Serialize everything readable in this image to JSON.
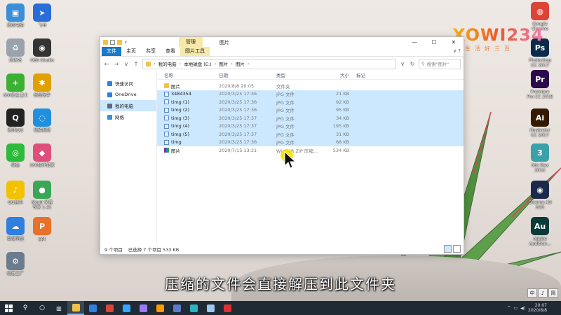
{
  "desktop_left": [
    {
      "label": "我的电脑",
      "color": "#3a8fd8",
      "glyph": "▣",
      "icon": "computer-icon"
    },
    {
      "label": "回收站",
      "color": "#9aa3ad",
      "glyph": "♻",
      "icon": "recycle-bin-icon"
    },
    {
      "label": "360安全卫士",
      "color": "#3cb035",
      "glyph": "+",
      "icon": "security-guard-icon"
    },
    {
      "label": "腾讯QQ",
      "color": "#222",
      "glyph": "Q",
      "icon": "qq-icon"
    },
    {
      "label": "微信",
      "color": "#2dbb3b",
      "glyph": "◎",
      "icon": "wechat-icon"
    },
    {
      "label": "QQ音乐",
      "color": "#f2c200",
      "glyph": "♪",
      "icon": "qq-music-icon"
    },
    {
      "label": "百度网盘",
      "color": "#2f7fe0",
      "glyph": "☁",
      "icon": "baidu-netdisk-icon"
    },
    {
      "label": "修复工厂",
      "color": "#6b7c8e",
      "glyph": "⚙",
      "icon": "repair-tool-icon"
    }
  ],
  "desktop_col2": [
    {
      "label": "飞书",
      "color": "#2a6cd8",
      "glyph": "➤",
      "icon": "feishu-icon"
    },
    {
      "label": "OBS Studio",
      "color": "#333",
      "glyph": "◉",
      "icon": "obs-icon"
    },
    {
      "label": "蚂蚁助手",
      "color": "#e0a000",
      "glyph": "✱",
      "icon": "ant-assistant-icon"
    },
    {
      "label": "优酷视频",
      "color": "#1f8fe0",
      "glyph": "◌",
      "icon": "youku-icon"
    },
    {
      "label": "360软件管家",
      "color": "#e04f7c",
      "glyph": "◆",
      "icon": "software-manager-icon"
    },
    {
      "label": "Moo0 录音\n专家 1.41",
      "color": "#3aa657",
      "glyph": "●",
      "icon": "recorder-icon"
    },
    {
      "label": "ppt",
      "color": "#e8702a",
      "glyph": "P",
      "icon": "ppt-file-icon"
    }
  ],
  "desktop_right": [
    {
      "label": "Google\nChrome",
      "color": "#db4437",
      "glyph": "◍",
      "icon": "chrome-icon"
    },
    {
      "label": "Photoshop\nCC 2017",
      "color": "#0a2b4c",
      "glyph": "Ps",
      "icon": "photoshop-icon"
    },
    {
      "label": "Premiere\nPro CC 2018",
      "color": "#2a0a4a",
      "glyph": "Pr",
      "icon": "premiere-icon"
    },
    {
      "label": "Illustrator\nCC 2017",
      "color": "#331a00",
      "glyph": "Ai",
      "icon": "illustrator-icon"
    },
    {
      "label": "3ds Max\n2015",
      "color": "#3aa1a8",
      "glyph": "3",
      "icon": "3dsmax-icon"
    },
    {
      "label": "Cinema 4D\nR20",
      "color": "#1b2a4a",
      "glyph": "◉",
      "icon": "cinema4d-icon"
    },
    {
      "label": "Adobe\nAudition...",
      "color": "#0a3a3a",
      "glyph": "Au",
      "icon": "audition-icon"
    }
  ],
  "watermark": {
    "logo": "XOWI234",
    "sub": "好生活好三百"
  },
  "window": {
    "title": "图片",
    "context_tab": "管理",
    "ribbon_tabs": [
      "文件",
      "主页",
      "共享",
      "查看",
      "图片工具"
    ],
    "breadcrumb": [
      "我的电脑",
      "本地磁盘 (E:)",
      "图片",
      "图片"
    ],
    "search_placeholder": "搜索\"图片\"",
    "nav_items": [
      {
        "label": "快速访问",
        "color": "#2f7fe0",
        "icon": "quick-access-icon",
        "sel": false
      },
      {
        "label": "OneDrive",
        "color": "#2f7fe0",
        "icon": "onedrive-icon",
        "sel": false
      },
      {
        "label": "我的电脑",
        "color": "#5a6b7c",
        "icon": "computer-icon",
        "sel": true
      },
      {
        "label": "网络",
        "color": "#3a8fd8",
        "icon": "network-icon",
        "sel": false
      }
    ],
    "columns": {
      "name": "名称",
      "date": "日期",
      "type": "类型",
      "size": "大小",
      "tag": "标记"
    },
    "files": [
      {
        "name": "图片",
        "date": "2020/8/8 20:05",
        "type": "文件夹",
        "size": "",
        "kind": "folder",
        "sel": false
      },
      {
        "name": "3484354",
        "date": "2020/3/25 17:36",
        "type": "JPG 文件",
        "size": "21 KB",
        "kind": "jpg",
        "sel": true
      },
      {
        "name": "timg (1)",
        "date": "2020/3/25 17:36",
        "type": "JPG 文件",
        "size": "92 KB",
        "kind": "jpg",
        "sel": true
      },
      {
        "name": "timg (2)",
        "date": "2020/3/25 17:36",
        "type": "JPG 文件",
        "size": "95 KB",
        "kind": "jpg",
        "sel": true
      },
      {
        "name": "timg (3)",
        "date": "2020/3/25 17:37",
        "type": "JPG 文件",
        "size": "34 KB",
        "kind": "jpg",
        "sel": true
      },
      {
        "name": "timg (4)",
        "date": "2020/3/25 17:37",
        "type": "JPG 文件",
        "size": "195 KB",
        "kind": "jpg",
        "sel": true
      },
      {
        "name": "timg (5)",
        "date": "2020/3/25 17:37",
        "type": "JPG 文件",
        "size": "31 KB",
        "kind": "jpg",
        "sel": true
      },
      {
        "name": "timg",
        "date": "2020/3/25 17:36",
        "type": "JPG 文件",
        "size": "68 KB",
        "kind": "jpg",
        "sel": true
      },
      {
        "name": "图片",
        "date": "2020/7/15 13:21",
        "type": "WinRAR ZIP 压缩...",
        "size": "534 KB",
        "kind": "zip",
        "sel": false
      }
    ],
    "status": {
      "count": "9 个项目",
      "selected": "已选择 7 个项目 533 KB"
    }
  },
  "subtitle": "压缩的文件会直接解压到此文件夹",
  "taskbar": {
    "apps": [
      {
        "name": "explorer",
        "color": "#f1c24a",
        "active": true
      },
      {
        "name": "media",
        "color": "#2f7fe0",
        "active": false
      },
      {
        "name": "chrome",
        "color": "#db4437",
        "active": false
      },
      {
        "name": "photoshop",
        "color": "#31a8ff",
        "active": false
      },
      {
        "name": "premiere",
        "color": "#9a79ff",
        "active": false
      },
      {
        "name": "illustrator",
        "color": "#ff9a00",
        "active": false
      },
      {
        "name": "cinema4d",
        "color": "#5a7ccc",
        "active": false
      },
      {
        "name": "3dsmax",
        "color": "#2bb3c0",
        "active": false
      },
      {
        "name": "cloud",
        "color": "#9ec7ef",
        "active": false
      },
      {
        "name": "recorder",
        "color": "#e03030",
        "active": false
      }
    ],
    "clock_time": "20:07",
    "clock_date": "2020/8/8"
  },
  "ime": [
    "中",
    "♪",
    "简"
  ]
}
